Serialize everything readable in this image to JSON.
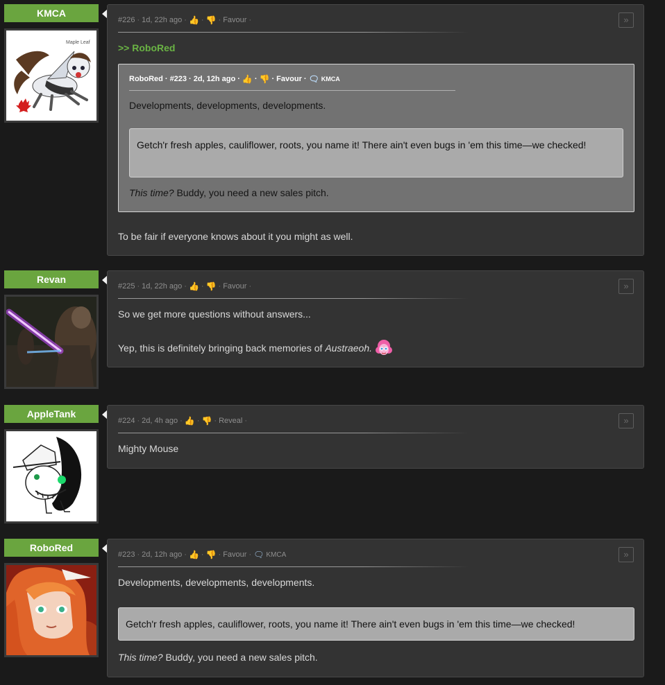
{
  "colors": {
    "accent": "#6aa53f",
    "card_bg": "#333333",
    "page_bg": "#1a1a1a",
    "reply_link": "#6ab344"
  },
  "icons": {
    "upvote": "thumbs-up-icon",
    "downvote": "thumbs-down-icon",
    "reply": "speech-bubble-icon",
    "jump": "double-chevron-right-icon"
  },
  "posts": [
    {
      "author": "KMCA",
      "avatar_text": "Maple Leaf",
      "id": "#226",
      "time": "1d, 22h ago",
      "action": "Favour",
      "reply_to": ">> RoboRed",
      "quote": {
        "author": "RoboRed",
        "id": "#223",
        "time": "2d, 12h ago",
        "action": "Favour",
        "reply_user": "KMCA",
        "line1": "Developments, developments, developments.",
        "box": "Getch'r fresh apples, cauliflower, roots, you name it! There ain't even bugs in 'em this time—we checked!",
        "italic": "This time?",
        "rest": " Buddy, you need a new sales pitch."
      },
      "text": "To be fair if everyone knows about it you might as well."
    },
    {
      "author": "Revan",
      "id": "#225",
      "time": "1d, 22h ago",
      "action": "Favour",
      "line1": "So we get more questions without answers...",
      "line2_prefix": "Yep, this is definitely bringing back memories of ",
      "line2_italic": "Austraeoh.",
      "emote": "pinkie-pie-emote"
    },
    {
      "author": "AppleTank",
      "id": "#224",
      "time": "2d, 4h ago",
      "action": "Reveal",
      "text": "Mighty Mouse"
    },
    {
      "author": "RoboRed",
      "id": "#223",
      "time": "2d, 12h ago",
      "action": "Favour",
      "reply_user": "KMCA",
      "line1": "Developments, developments, developments.",
      "box": "Getch'r fresh apples, cauliflower, roots, you name it! There ain't even bugs in 'em this time—we checked!",
      "italic": "This time?",
      "rest": " Buddy, you need a new sales pitch."
    }
  ]
}
